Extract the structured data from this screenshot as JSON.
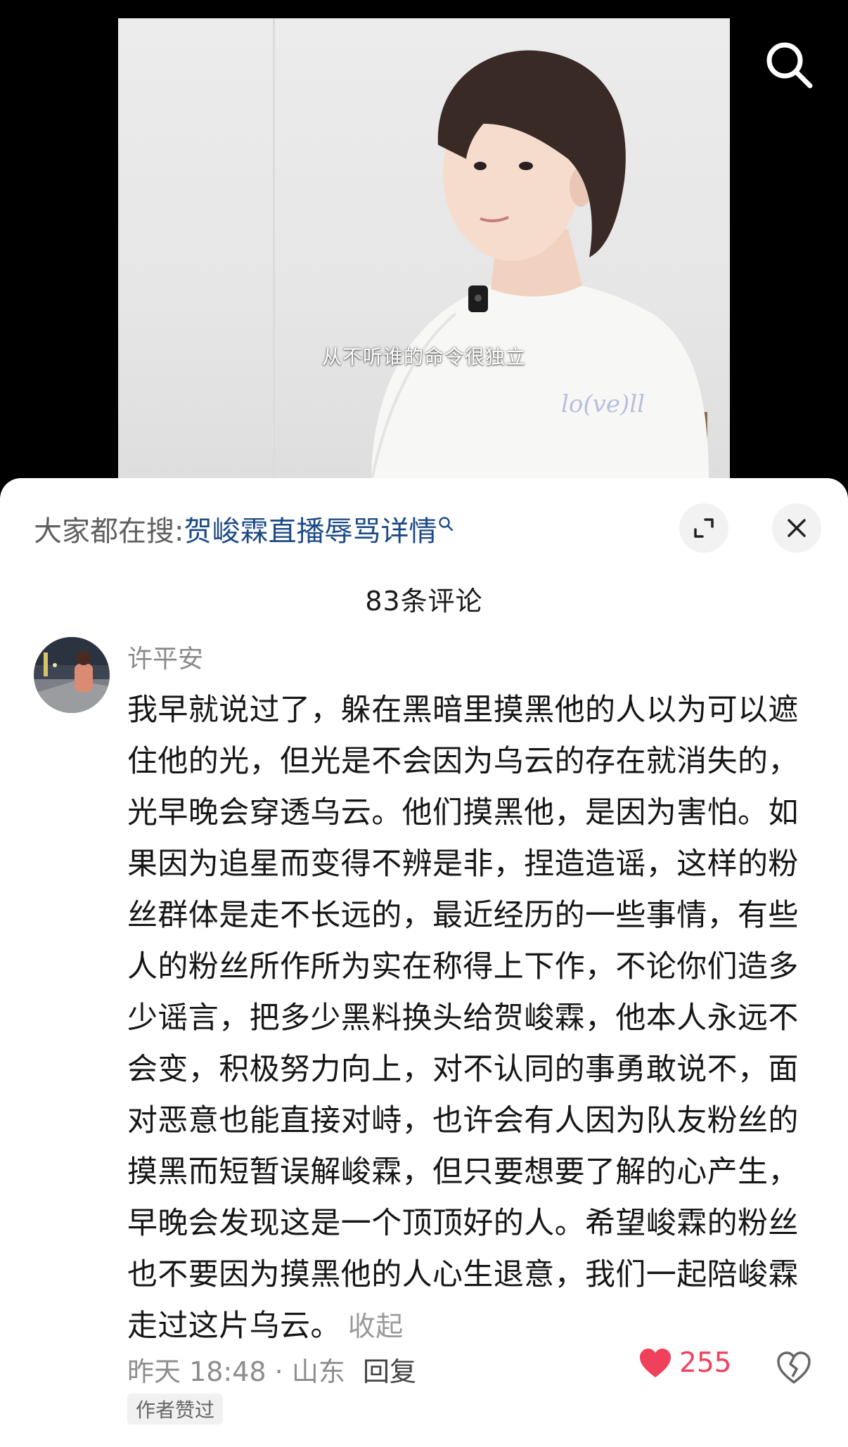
{
  "video": {
    "subtitle": "从不听谁的命令很独立",
    "shirt_print": "lo(ve)ll"
  },
  "top_search": {
    "icon": "search-icon"
  },
  "hot_search": {
    "prefix": "大家都在搜:",
    "term": "贺峻霖直播辱骂详情",
    "term_icon": "mini-search-icon"
  },
  "header_buttons": {
    "expand_icon": "expand-icon",
    "close_icon": "close-icon"
  },
  "comments_header": {
    "count_label": "83条评论"
  },
  "comment": {
    "username": "许平安",
    "text": "我早就说过了，躲在黑暗里摸黑他的人以为可以遮住他的光，但光是不会因为乌云的存在就消失的，光早晚会穿透乌云。他们摸黑他，是因为害怕。如果因为追星而变得不辨是非，捏造造谣，这样的粉丝群体是走不长远的，最近经历的一些事情，有些人的粉丝所作所为实在称得上下作，不论你们造多少谣言，把多少黑料换头给贺峻霖，他本人永远不会变，积极努力向上，对不认同的事勇敢说不，面对恶意也能直接对峙，也许会有人因为队友粉丝的摸黑而短暂误解峻霖，但只要想要了解的心产生，早晚会发现这是一个顶顶好的人。希望峻霖的粉丝也不要因为摸黑他的人心生退意，我们一起陪峻霖走过这片乌云。",
    "collapse_label": "收起",
    "meta": "昨天 18:48 · 山东",
    "reply_label": "回复",
    "like_count": "255",
    "author_badge": "作者赞过"
  },
  "colors": {
    "accent_like": "#f0415c",
    "hot_search_link": "#1c4a86"
  }
}
